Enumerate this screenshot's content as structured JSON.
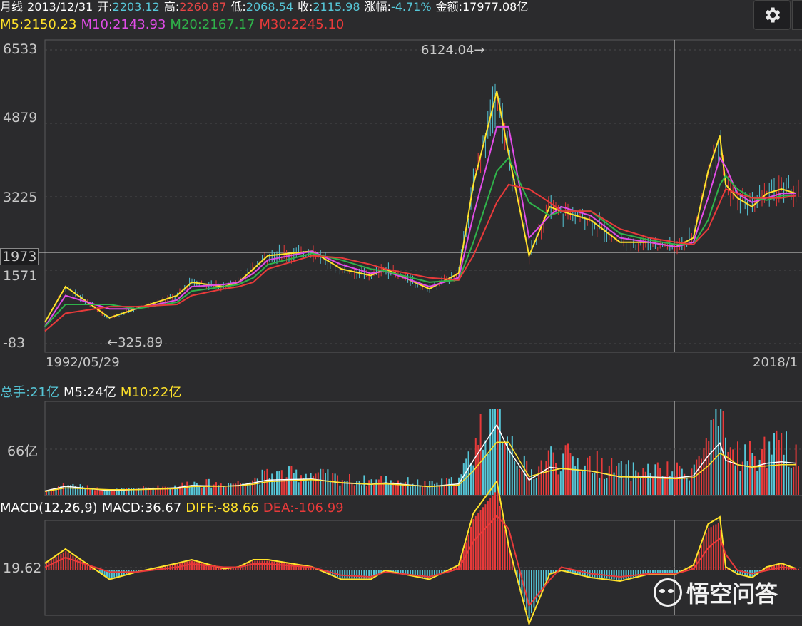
{
  "header": {
    "items": [
      {
        "label": "月线",
        "value": "",
        "color": "#ffffff"
      },
      {
        "label": "2013/12/31",
        "value": "",
        "color": "#ffffff"
      },
      {
        "label": "开:",
        "value": "2203.12",
        "color": "#56c7d8"
      },
      {
        "label": "高:",
        "value": "2260.87",
        "color": "#e84545"
      },
      {
        "label": "低:",
        "value": "2068.54",
        "color": "#56c7d8"
      },
      {
        "label": "收:",
        "value": "2115.98",
        "color": "#56c7d8"
      },
      {
        "label": "涨幅:",
        "value": "-4.71%",
        "color": "#56c7d8"
      },
      {
        "label": "金额:",
        "value": "17977.08亿",
        "color": "#ffffff"
      }
    ],
    "ma": [
      {
        "text": "M5:2150.23",
        "color": "#ffe22a"
      },
      {
        "text": "M10:2143.93",
        "color": "#e14ce8"
      },
      {
        "text": "M20:2167.17",
        "color": "#2fb34a"
      },
      {
        "text": "M30:2245.10",
        "color": "#e83a3a"
      }
    ]
  },
  "price_axis": {
    "labels": [
      "6533",
      "4879",
      "3225",
      "1973",
      "1571",
      "-83"
    ]
  },
  "annotations": {
    "high": "6124.04→",
    "low": "←325.89"
  },
  "x_axis": {
    "start": "1992/05/29",
    "end": "2018/1"
  },
  "volume": {
    "items": [
      {
        "text": "总手:21亿",
        "color": "#56c7d8"
      },
      {
        "text": "M5:24亿",
        "color": "#ffffff"
      },
      {
        "text": "M10:22亿",
        "color": "#ffe22a"
      }
    ],
    "axis_label": "66亿"
  },
  "macd": {
    "items": [
      {
        "text": "MACD(12,26,9)",
        "color": "#ffffff"
      },
      {
        "text": "MACD:36.67",
        "color": "#ffffff"
      },
      {
        "text": "DIFF:-88.66",
        "color": "#ffe22a"
      },
      {
        "text": "DEA:-106.99",
        "color": "#e83a3a"
      }
    ],
    "axis_label": "19.62"
  },
  "settings_icon": "gear-icon",
  "watermark": "悟空问答",
  "chart_data": {
    "type": "line",
    "title": "",
    "x_range": [
      "1992/05/29",
      "2018"
    ],
    "ylim": [
      -83,
      6533
    ],
    "y_ticks": [
      6533,
      4879,
      3225,
      1973,
      1571,
      -83
    ],
    "crosshair_y": 1973,
    "annotated_high": 6124.04,
    "annotated_low": 325.89,
    "x": [
      1992.4,
      1993.1,
      1994.6,
      1995.5,
      1996.9,
      1997.4,
      1998.5,
      1999.0,
      1999.5,
      2000.0,
      2001.5,
      2002.5,
      2003.5,
      2004.0,
      2005.5,
      2006.5,
      2007.0,
      2007.8,
      2008.2,
      2008.9,
      2009.6,
      2010.0,
      2011.0,
      2012.0,
      2013.0,
      2013.9,
      2014.5,
      2015.0,
      2015.4,
      2015.6,
      2016.0,
      2016.5,
      2017.0,
      2017.5,
      2018.0
    ],
    "series": [
      {
        "name": "M5",
        "color": "#ffe22a",
        "values": [
          400,
          1200,
          500,
          700,
          1000,
          1300,
          1200,
          1300,
          1600,
          1900,
          2000,
          1600,
          1450,
          1600,
          1150,
          1500,
          3500,
          5600,
          4200,
          1900,
          3000,
          2900,
          2700,
          2200,
          2200,
          2100,
          2300,
          3800,
          4600,
          3500,
          3200,
          3000,
          3300,
          3400,
          3300
        ]
      },
      {
        "name": "M10",
        "color": "#e14ce8",
        "values": [
          300,
          1000,
          700,
          700,
          900,
          1200,
          1250,
          1300,
          1500,
          1800,
          2000,
          1700,
          1500,
          1550,
          1200,
          1400,
          2800,
          4800,
          4800,
          2300,
          2800,
          3000,
          2800,
          2300,
          2200,
          2100,
          2200,
          3200,
          4100,
          3900,
          3300,
          3100,
          3200,
          3300,
          3300
        ]
      },
      {
        "name": "M20",
        "color": "#2fb34a",
        "values": [
          300,
          800,
          800,
          700,
          850,
          1100,
          1200,
          1250,
          1400,
          1700,
          1950,
          1800,
          1600,
          1550,
          1300,
          1350,
          2200,
          3800,
          4100,
          3100,
          2800,
          2900,
          2900,
          2400,
          2250,
          2150,
          2150,
          2700,
          3500,
          3700,
          3400,
          3200,
          3150,
          3250,
          3250
        ]
      },
      {
        "name": "M30",
        "color": "#e83a3a",
        "values": [
          200,
          600,
          750,
          750,
          800,
          1000,
          1150,
          1200,
          1300,
          1600,
          1900,
          1850,
          1700,
          1600,
          1400,
          1350,
          1900,
          3100,
          3500,
          3400,
          3100,
          2900,
          2900,
          2500,
          2300,
          2200,
          2150,
          2500,
          3100,
          3400,
          3300,
          3200,
          3200,
          3200,
          3250
        ]
      }
    ]
  }
}
